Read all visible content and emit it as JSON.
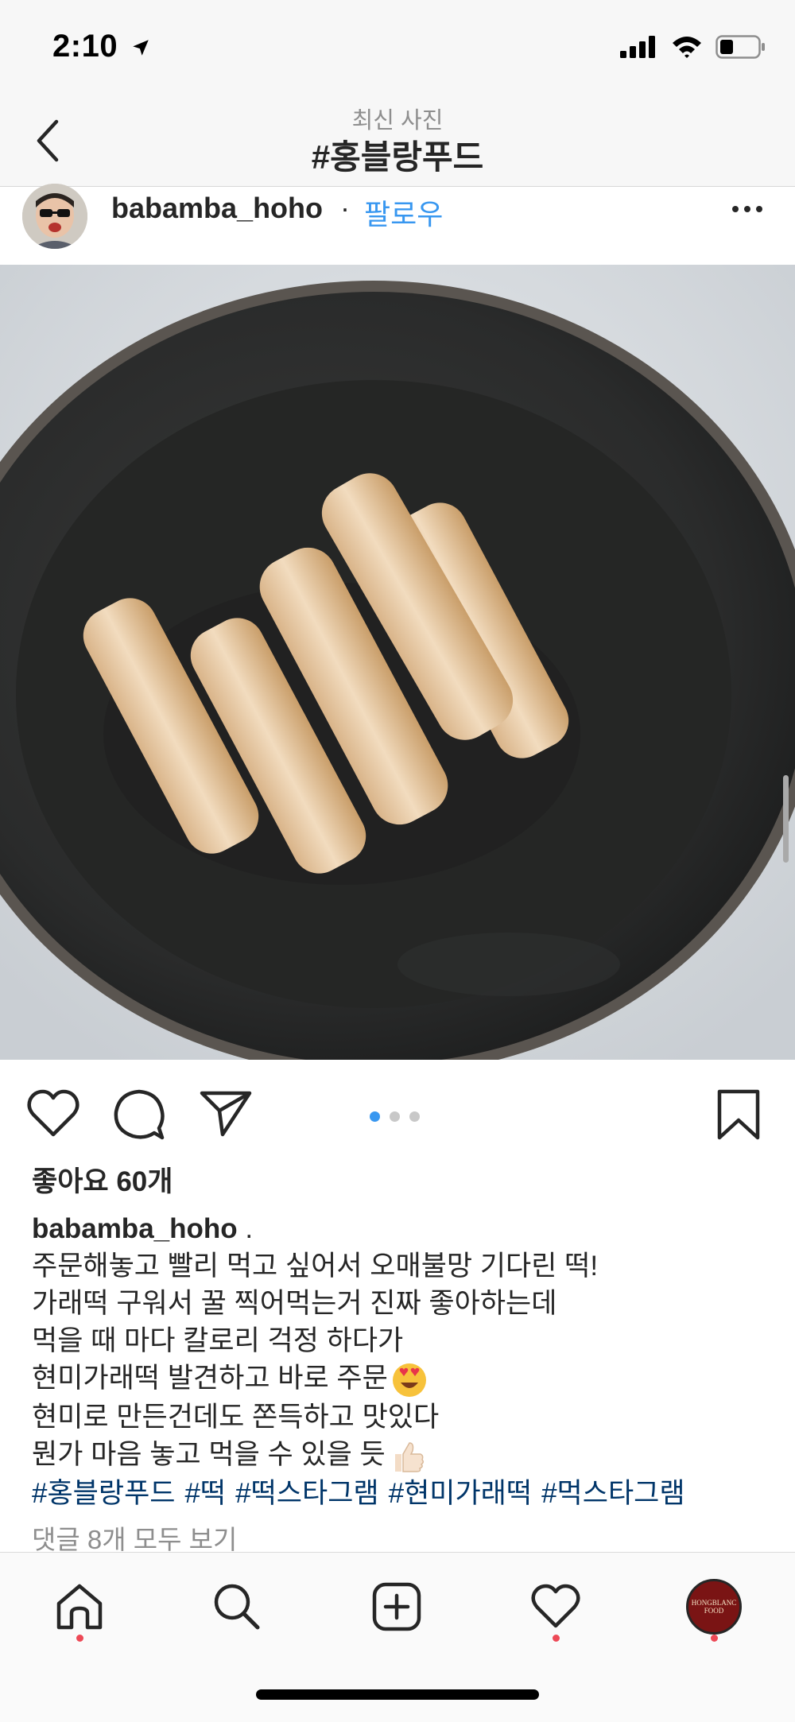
{
  "status_bar": {
    "time": "2:10"
  },
  "header": {
    "subtitle": "최신 사진",
    "title": "#홍블랑푸드"
  },
  "post": {
    "username": "babamba_hoho",
    "separator": "·",
    "follow_label": "팔로우",
    "photo_description_icon": "rice-cake-photo",
    "carousel": {
      "count": 3,
      "active_index": 0
    },
    "likes": "좋아요 60개",
    "caption": {
      "username": "babamba_hoho",
      "suffix": " .",
      "lines": [
        "주문해놓고 빨리 먹고 싶어서 오매불망 기다린 떡!",
        "가래떡 구워서 꿀 찍어먹는거 진짜 좋아하는데",
        "먹을 때 마다 칼로리 걱정 하다가",
        "현미가래떡 발견하고 바로 주문",
        "현미로 만든건데도 쫀득하고 맛있다",
        "뭔가 마음 놓고 먹을 수 있을 듯"
      ],
      "hashtags": [
        "#홍블랑푸드",
        "#떡",
        "#떡스타그램",
        "#현미가래떡",
        "#먹스타그램"
      ]
    },
    "view_comments": "댓글 8개 모두 보기"
  },
  "tab_bar": {
    "items": [
      "home-icon",
      "search-icon",
      "new-post-icon",
      "activity-icon",
      "profile-avatar"
    ],
    "profile_badge_text": "HONGBLANC FOOD"
  },
  "colors": {
    "link_blue": "#3897f0",
    "hashtag_blue": "#003569",
    "notification_red": "#ed4956"
  }
}
